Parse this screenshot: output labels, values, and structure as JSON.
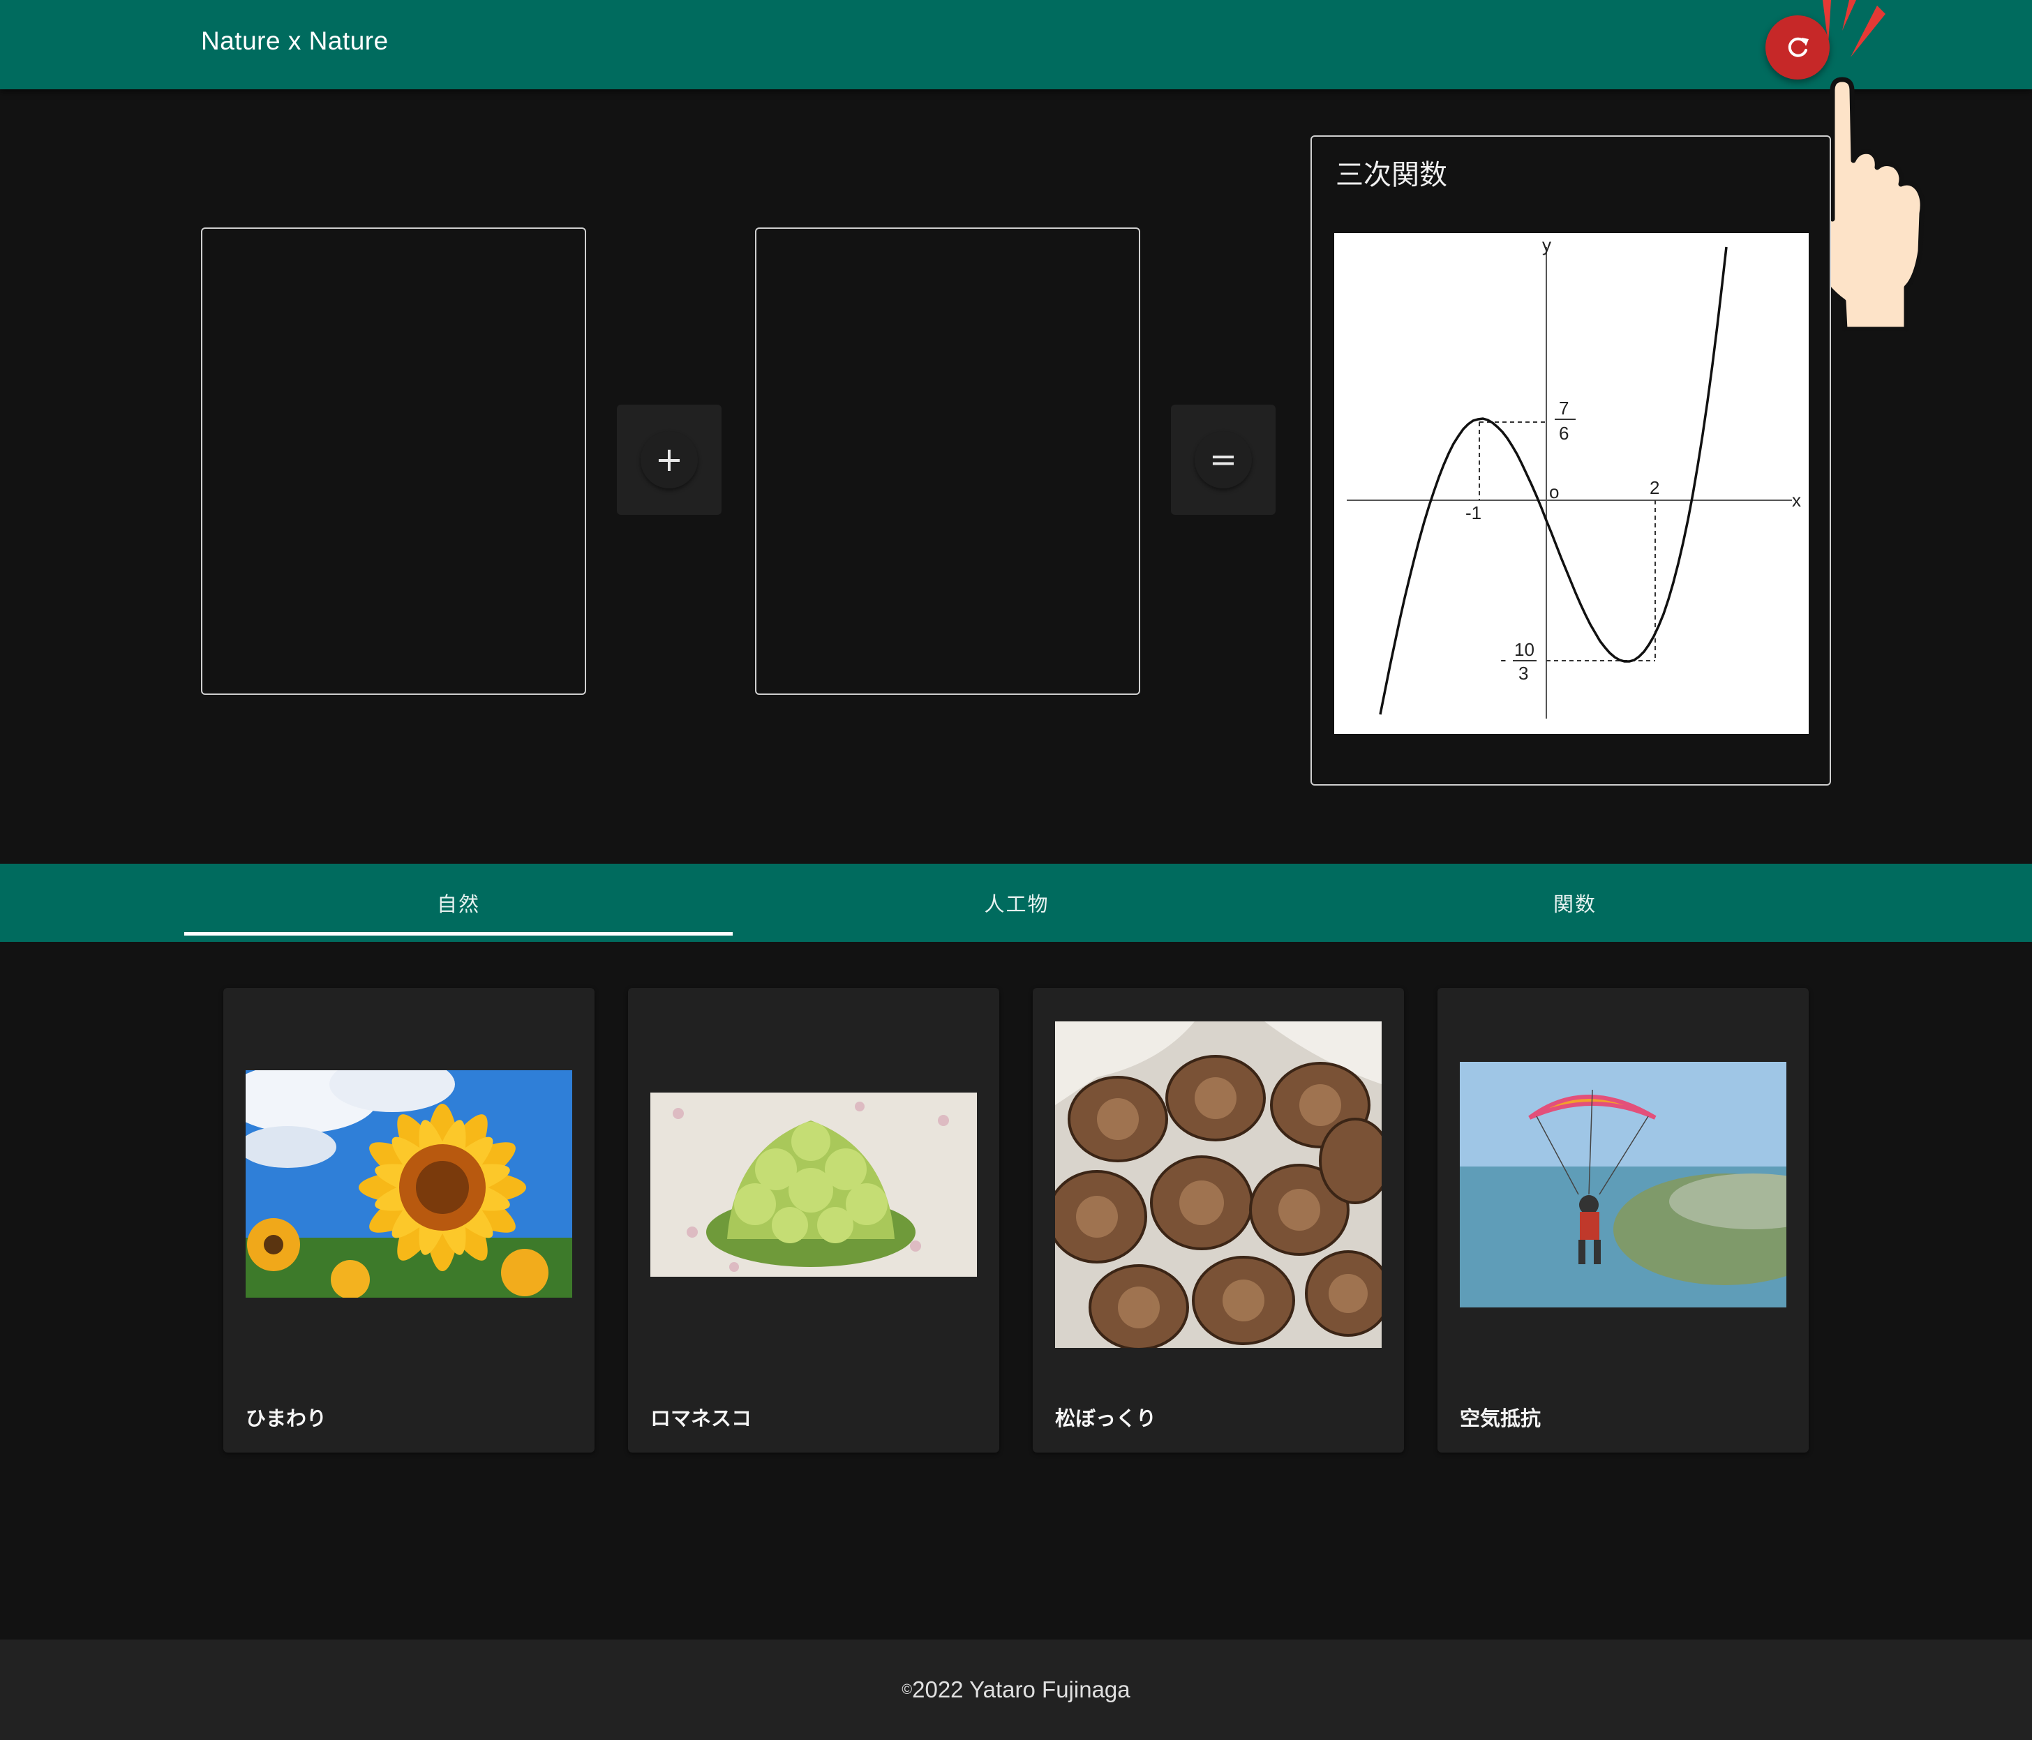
{
  "header": {
    "title": "Nature x Nature",
    "reset_icon": "refresh-icon"
  },
  "operators": {
    "plus": "+",
    "equals": "="
  },
  "result": {
    "title": "三次関数",
    "graph": {
      "axis_x": "x",
      "axis_y": "y",
      "origin": "o",
      "tick_neg1": "-1",
      "tick_2": "2",
      "max_num": "7",
      "max_den": "6",
      "min_sign": "-",
      "min_num": "10",
      "min_den": "3"
    }
  },
  "tabs": [
    "自然",
    "人工物",
    "関数"
  ],
  "active_tab": 0,
  "cards": [
    {
      "label": "ひまわり"
    },
    {
      "label": "ロマネスコ"
    },
    {
      "label": "松ぼっくり"
    },
    {
      "label": "空気抵抗"
    }
  ],
  "footer": {
    "copyright": "©",
    "text": "2022 Yataro Fujinaga"
  },
  "colors": {
    "primary": "#006b5e",
    "background": "#121212",
    "card": "#212121",
    "reset": "#c62828"
  }
}
